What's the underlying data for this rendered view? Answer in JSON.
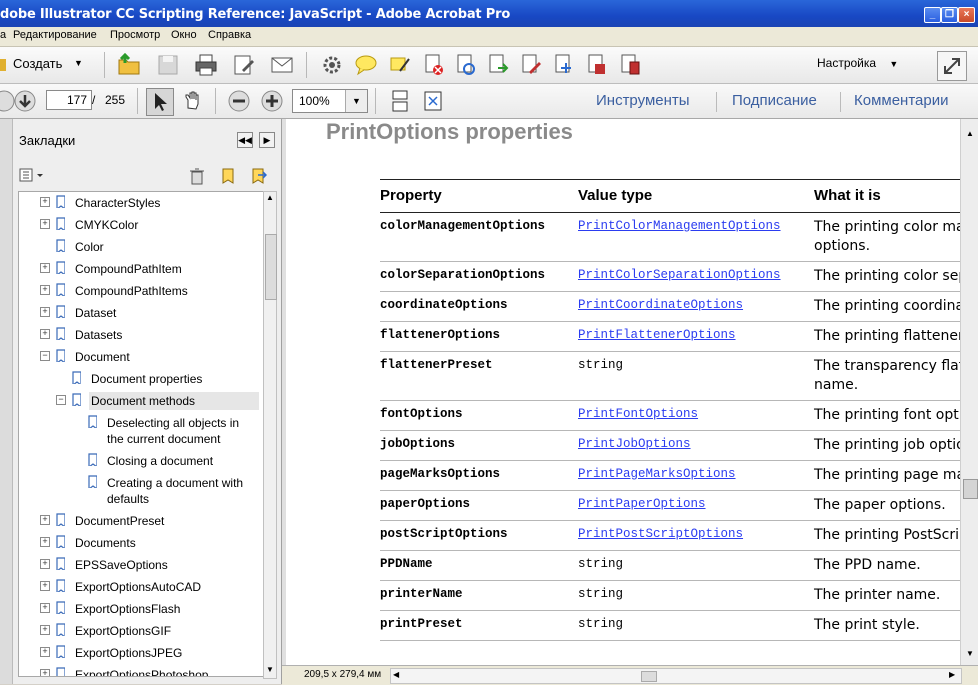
{
  "window": {
    "title": "dobe Illustrator CC Scripting Reference: JavaScript - Adobe Acrobat Pro"
  },
  "menu": [
    "а",
    "Редактирование",
    "Просмотр",
    "Окно",
    "Справка"
  ],
  "toolbar": {
    "create_label": "Создать",
    "settings_label": "Настройка"
  },
  "nav": {
    "page_current": "177",
    "page_separator": "/",
    "page_total": "255",
    "zoom": "100%"
  },
  "panels": {
    "tools": "Инструменты",
    "sign": "Подписание",
    "comments": "Комментарии"
  },
  "bookmarks": {
    "title": "Закладки",
    "items": [
      {
        "label": "CharacterStyles",
        "level": 0,
        "expander": "+"
      },
      {
        "label": "CMYKColor",
        "level": 0,
        "expander": "+"
      },
      {
        "label": "Color",
        "level": 0,
        "expander": ""
      },
      {
        "label": "CompoundPathItem",
        "level": 0,
        "expander": "+"
      },
      {
        "label": "CompoundPathItems",
        "level": 0,
        "expander": "+"
      },
      {
        "label": "Dataset",
        "level": 0,
        "expander": "+"
      },
      {
        "label": "Datasets",
        "level": 0,
        "expander": "+"
      },
      {
        "label": "Document",
        "level": 0,
        "expander": "−"
      },
      {
        "label": "Document properties",
        "level": 1,
        "expander": ""
      },
      {
        "label": "Document methods",
        "level": 1,
        "expander": "−",
        "selected": true
      },
      {
        "label": "Deselecting all objects in",
        "label2": "the current document",
        "level": 2,
        "expander": ""
      },
      {
        "label": "Closing a document",
        "level": 2,
        "expander": ""
      },
      {
        "label": "Creating a document with",
        "label2": "defaults",
        "level": 2,
        "expander": ""
      },
      {
        "label": "DocumentPreset",
        "level": 0,
        "expander": "+"
      },
      {
        "label": "Documents",
        "level": 0,
        "expander": "+"
      },
      {
        "label": "EPSSaveOptions",
        "level": 0,
        "expander": "+"
      },
      {
        "label": "ExportOptionsAutoCAD",
        "level": 0,
        "expander": "+"
      },
      {
        "label": "ExportOptionsFlash",
        "level": 0,
        "expander": "+"
      },
      {
        "label": "ExportOptionsGIF",
        "level": 0,
        "expander": "+"
      },
      {
        "label": "ExportOptionsJPEG",
        "level": 0,
        "expander": "+"
      },
      {
        "label": "ExportOptionsPhotoshop",
        "level": 0,
        "expander": "+"
      }
    ]
  },
  "document": {
    "heading": "PrintOptions properties",
    "columns": [
      "Property",
      "Value type",
      "What it is"
    ],
    "rows": [
      {
        "property": "colorManagementOptions",
        "type": "PrintColorManagementOptions",
        "link": true,
        "desc": "The printing color mar",
        "desc2": "options."
      },
      {
        "property": "colorSeparationOptions",
        "type": "PrintColorSeparationOptions",
        "link": true,
        "desc": "The printing color sep"
      },
      {
        "property": "coordinateOptions",
        "type": "PrintCoordinateOptions",
        "link": true,
        "desc": "The printing coordinat"
      },
      {
        "property": "flattenerOptions",
        "type": "PrintFlattenerOptions",
        "link": true,
        "desc": "The printing flattener"
      },
      {
        "property": "flattenerPreset",
        "type": "string",
        "link": false,
        "desc": "The transparency flatt",
        "desc2": "name."
      },
      {
        "property": "fontOptions",
        "type": "PrintFontOptions",
        "link": true,
        "desc": "The printing font optio"
      },
      {
        "property": "jobOptions",
        "type": "PrintJobOptions",
        "link": true,
        "desc": "The printing job optio"
      },
      {
        "property": "pageMarksOptions",
        "type": "PrintPageMarksOptions",
        "link": true,
        "desc": "The printing page mar"
      },
      {
        "property": "paperOptions",
        "type": "PrintPaperOptions",
        "link": true,
        "desc": "The paper options."
      },
      {
        "property": "postScriptOptions",
        "type": "PrintPostScriptOptions",
        "link": true,
        "desc": "The printing PostScrip"
      },
      {
        "property": "PPDName",
        "type": "string",
        "link": false,
        "desc": "The PPD name."
      },
      {
        "property": "printerName",
        "type": "string",
        "link": false,
        "desc": "The printer name."
      },
      {
        "property": "printPreset",
        "type": "string",
        "link": false,
        "desc": "The print style."
      }
    ]
  },
  "status": {
    "page_size": "209,5 x 279,4 мм"
  },
  "colors": {
    "titlebar": "#1848c4",
    "link": "#2b3cf0",
    "heading": "#8a8a8a",
    "tools_link": "#3b5fa0"
  }
}
